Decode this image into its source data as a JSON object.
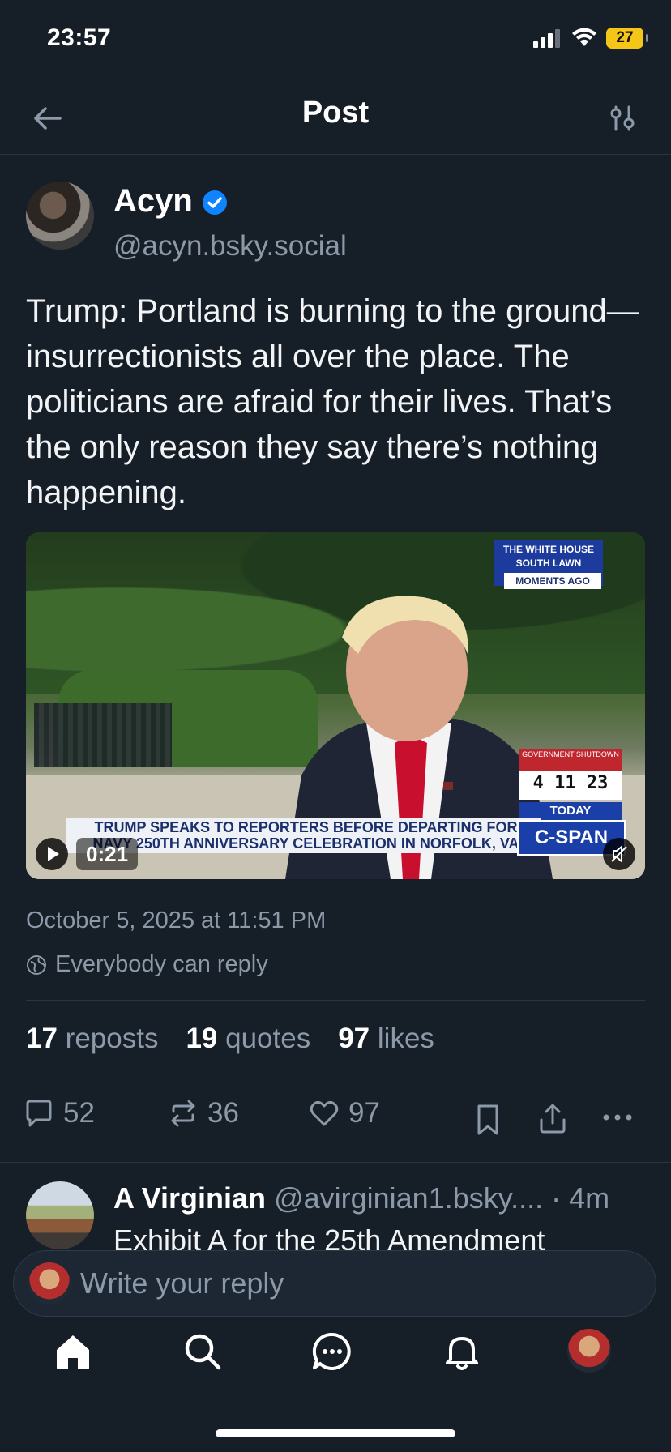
{
  "status_bar": {
    "time": "23:57",
    "battery": "27"
  },
  "header": {
    "title": "Post"
  },
  "post": {
    "author_name": "Acyn",
    "author_handle": "@acyn.bsky.social",
    "text": "Trump: Portland is burning to the ground—insurrectionists all over the place. The politicians are afraid for their lives. That’s the only reason they say there’s nothing happening.",
    "video": {
      "duration": "0:21",
      "overlay_location": "THE WHITE HOUSE SOUTH LAWN",
      "overlay_moments": "MOMENTS AGO",
      "overlay_headline": "TRUMP SPEAKS TO REPORTERS BEFORE DEPARTING FOR NAVY 250TH ANNIVERSARY CELEBRATION IN NORFOLK, VA",
      "overlay_shutdown_label": "GOVERNMENT SHUTDOWN",
      "overlay_shutdown_count": "4 11 23",
      "overlay_today": "TODAY",
      "overlay_network": "C-SPAN"
    },
    "date": "October 5, 2025 at 11:51 PM",
    "reply_permission": "Everybody can reply",
    "stats": {
      "reposts_count": "17",
      "reposts_label": "reposts",
      "quotes_count": "19",
      "quotes_label": "quotes",
      "likes_count": "97",
      "likes_label": "likes"
    },
    "actions": {
      "replies": "52",
      "reposts": "36",
      "likes": "97"
    }
  },
  "reply": {
    "author_name": "A Virginian",
    "author_handle": "@avirginian1.bsky....",
    "time": "· 4m",
    "text": "Exhibit A for the 25th Amendment"
  },
  "composer": {
    "placeholder": "Write your reply"
  },
  "colors": {
    "background": "#161e27",
    "accent": "#1083fe",
    "muted": "#8c99a8"
  },
  "tabbar": {
    "items": [
      "home-icon",
      "search-icon",
      "chat-icon",
      "bell-icon",
      "profile-avatar"
    ]
  }
}
